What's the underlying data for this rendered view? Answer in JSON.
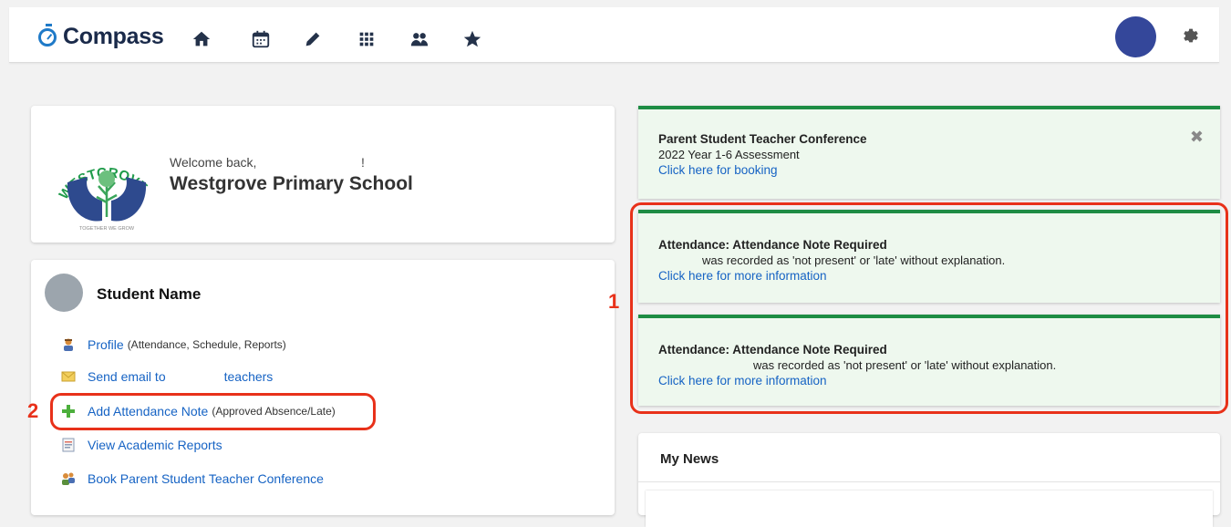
{
  "app": {
    "name": "Compass"
  },
  "nav": {
    "icons": [
      "home-icon",
      "calendar-icon",
      "pencil-icon",
      "grid-icon",
      "people-icon",
      "star-icon"
    ],
    "settings_icon": "gear-icon"
  },
  "welcome": {
    "greeting": "Welcome back,",
    "exclamation": "!",
    "school_name": "Westgrove Primary School",
    "logo_text": "WESTGROVE",
    "logo_tagline": "TOGETHER WE GROW"
  },
  "student": {
    "name": "Student Name",
    "links": [
      {
        "label": "Profile",
        "suffix": "(Attendance, Schedule, Reports)",
        "icon": "profile-icon"
      },
      {
        "label": "Send email to",
        "label_after": "teachers",
        "icon": "email-icon"
      },
      {
        "label": "Add Attendance Note",
        "suffix": "(Approved Absence/Late)",
        "icon": "plus-icon"
      },
      {
        "label": "View Academic Reports",
        "icon": "report-icon"
      },
      {
        "label": "Book Parent Student Teacher Conference",
        "icon": "conference-icon"
      }
    ]
  },
  "notices": [
    {
      "title": "Parent Student Teacher Conference",
      "body": "2022 Year 1-6 Assessment",
      "link": "Click here for booking"
    },
    {
      "title": "Attendance: Attendance Note Required",
      "body": "was recorded as 'not present' or 'late' without explanation.",
      "link": "Click here for more information"
    },
    {
      "title": "Attendance: Attendance Note Required",
      "body": "was recorded as 'not present' or 'late' without explanation.",
      "link": "Click here for more information"
    }
  ],
  "news": {
    "title": "My News"
  },
  "annotations": {
    "marker_1": "1",
    "marker_2": "2"
  },
  "colors": {
    "accent": "#1f7ac8",
    "link": "#1663c4",
    "notice_border": "#1e8c44",
    "notice_bg": "#eef8ee",
    "annotation_red": "#e8311a",
    "avatar": "#34479a"
  }
}
